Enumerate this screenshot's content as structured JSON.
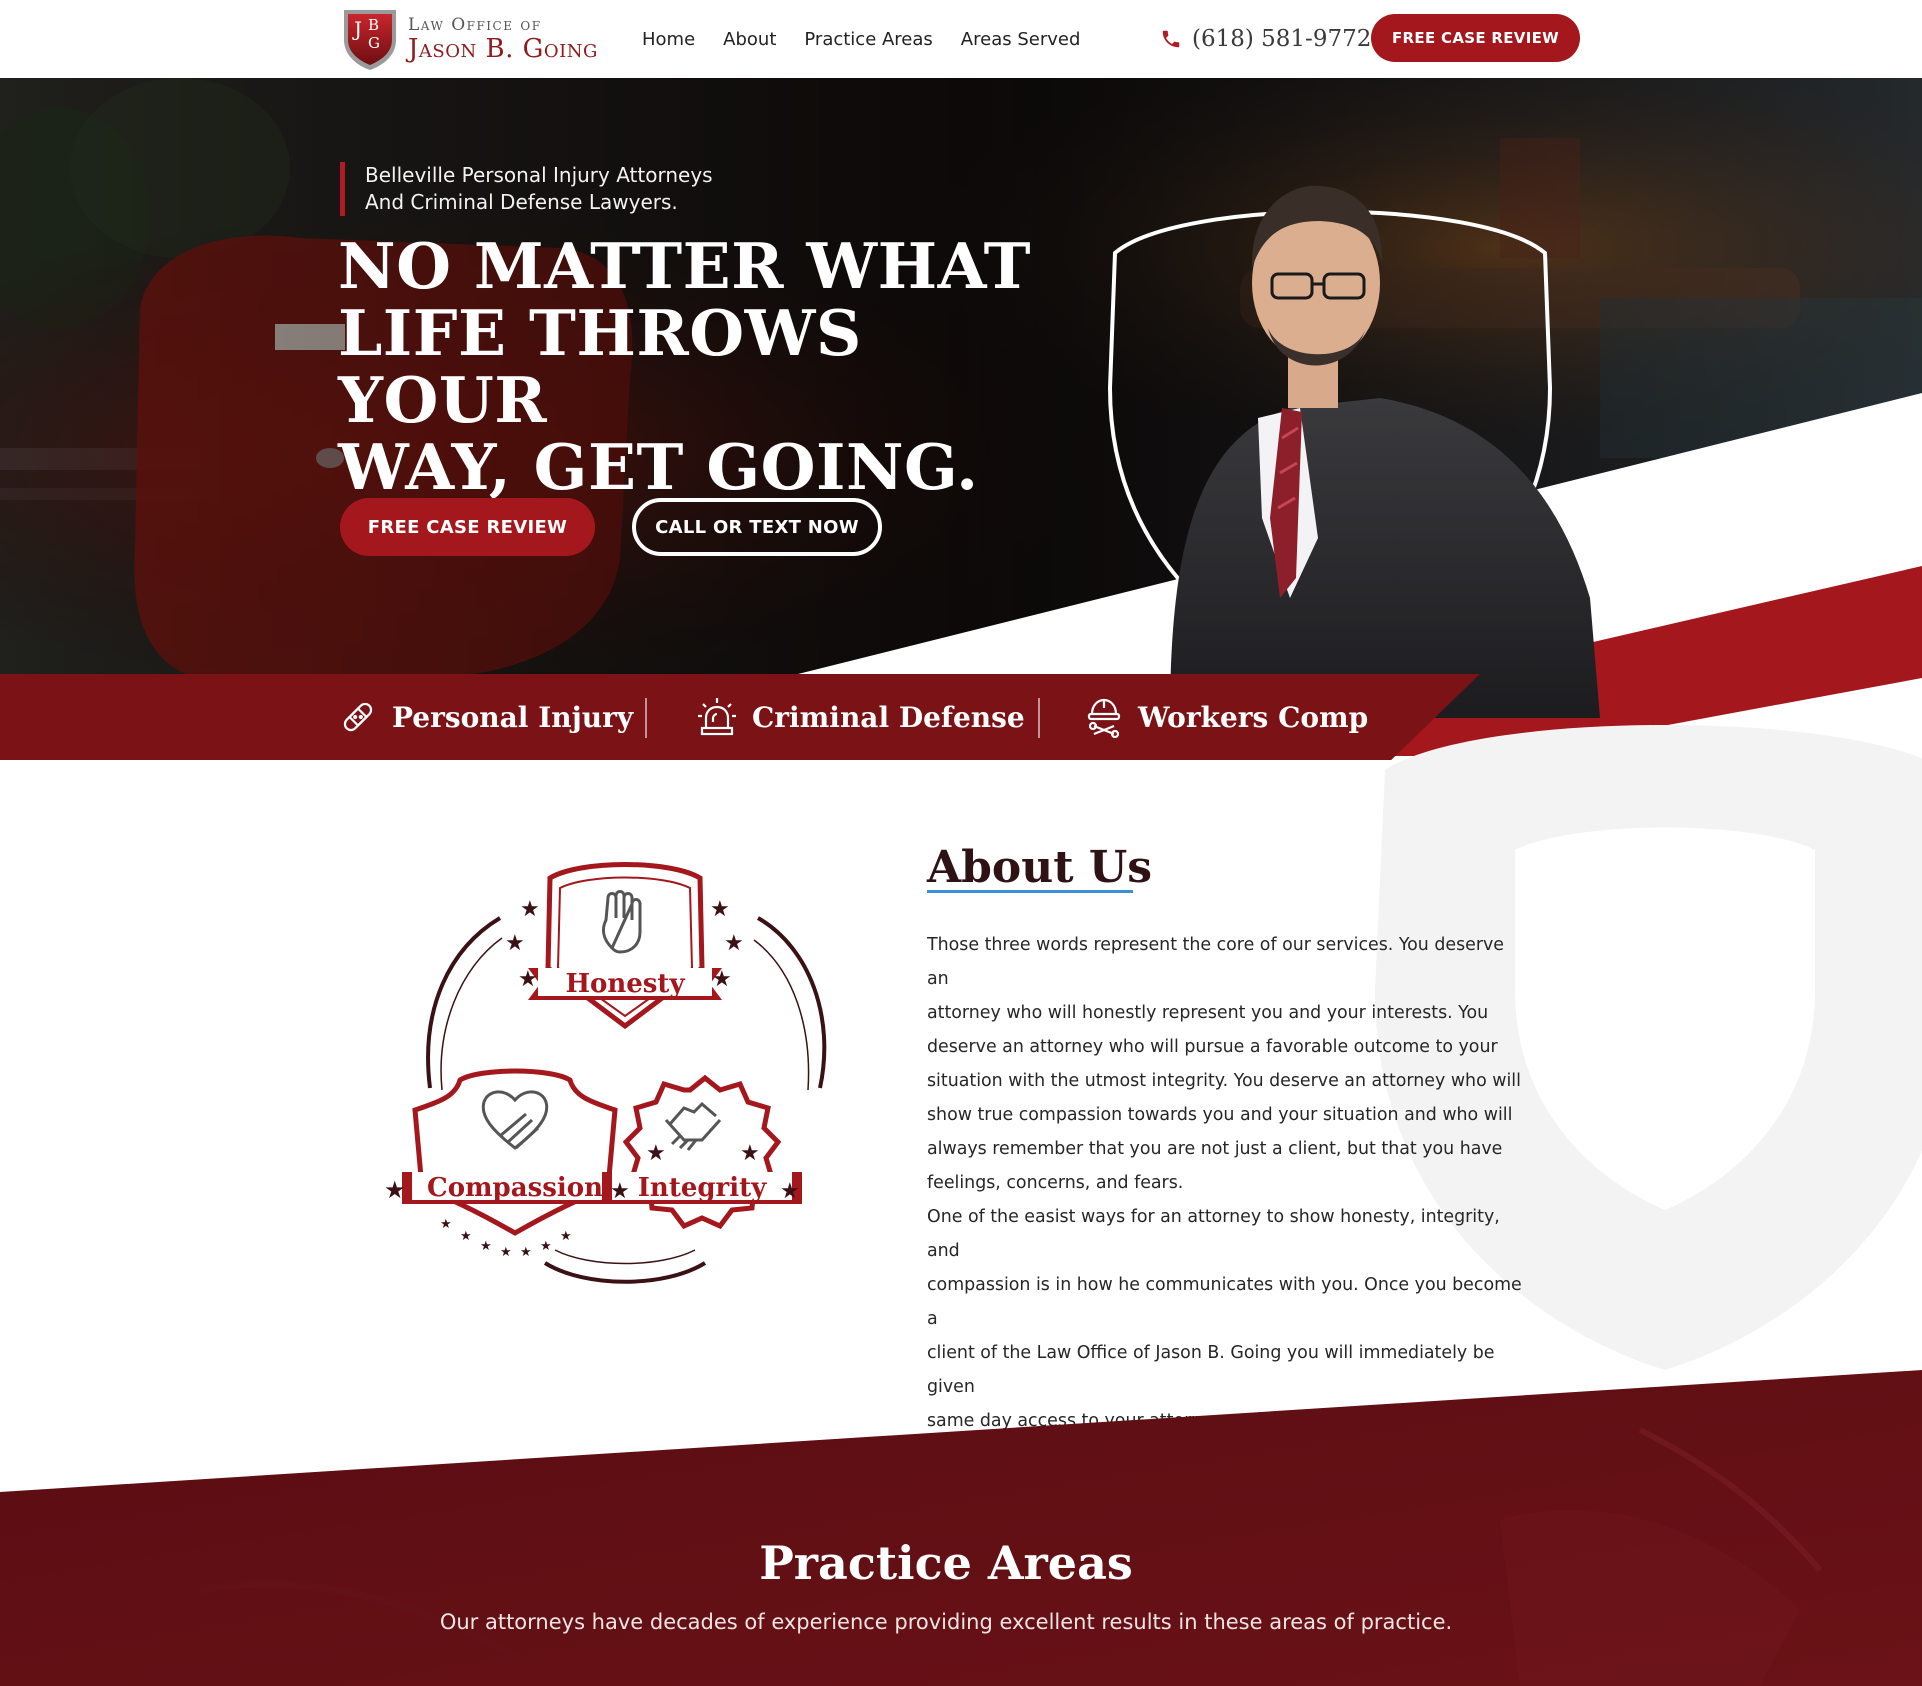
{
  "header": {
    "logo_monogram": "JBG",
    "logo_line1": "Law Office of",
    "logo_line2": "Jason B. Going",
    "nav": [
      "Home",
      "About",
      "Practice Areas",
      "Areas Served"
    ],
    "phone": "(618) 581-9772",
    "cta": "FREE CASE REVIEW"
  },
  "hero": {
    "tagline_1": "Belleville Personal Injury Attorneys",
    "tagline_2": "And Criminal Defense Lawyers.",
    "headline_1": "NO MATTER WHAT",
    "headline_2": "LIFE THROWS YOUR",
    "headline_3": "WAY, GET GOING.",
    "btn_primary": "FREE CASE REVIEW",
    "btn_secondary": "CALL OR TEXT NOW"
  },
  "practice_strip": [
    {
      "label": "Personal Injury",
      "icon": "bandage-icon"
    },
    {
      "label": "Criminal Defense",
      "icon": "siren-icon"
    },
    {
      "label": "Workers Comp",
      "icon": "hardhat-icon"
    }
  ],
  "about": {
    "title": "About Us",
    "badges": [
      "Honesty",
      "Compassion",
      "Integrity"
    ],
    "p1_lines": [
      "Those three words represent the core of our services.  You deserve an",
      "attorney who will honestly represent you and your interests.  You",
      "deserve an attorney who will pursue a favorable outcome to your",
      "situation with the utmost integrity.  You deserve an attorney who will",
      "show true compassion towards you and your situation and who will",
      "always remember that you are not just a client, but that you have",
      "feelings, concerns, and fears."
    ],
    "p2_lines": [
      "One of the easist ways for an attorney to show honesty, integrity, and",
      "compassion is in how he communicates with you.  Once you become a",
      "client of the Law Office of Jason B. Going you will immediately be given",
      "same day access to your attorney."
    ]
  },
  "practice_areas": {
    "title": "Practice Areas",
    "subtitle": "Our attorneys have decades of experience providing excellent results in these areas of practice."
  },
  "colors": {
    "brand_red": "#a4171d",
    "dark_red": "#7a1216",
    "maroon": "#5a0d12"
  }
}
